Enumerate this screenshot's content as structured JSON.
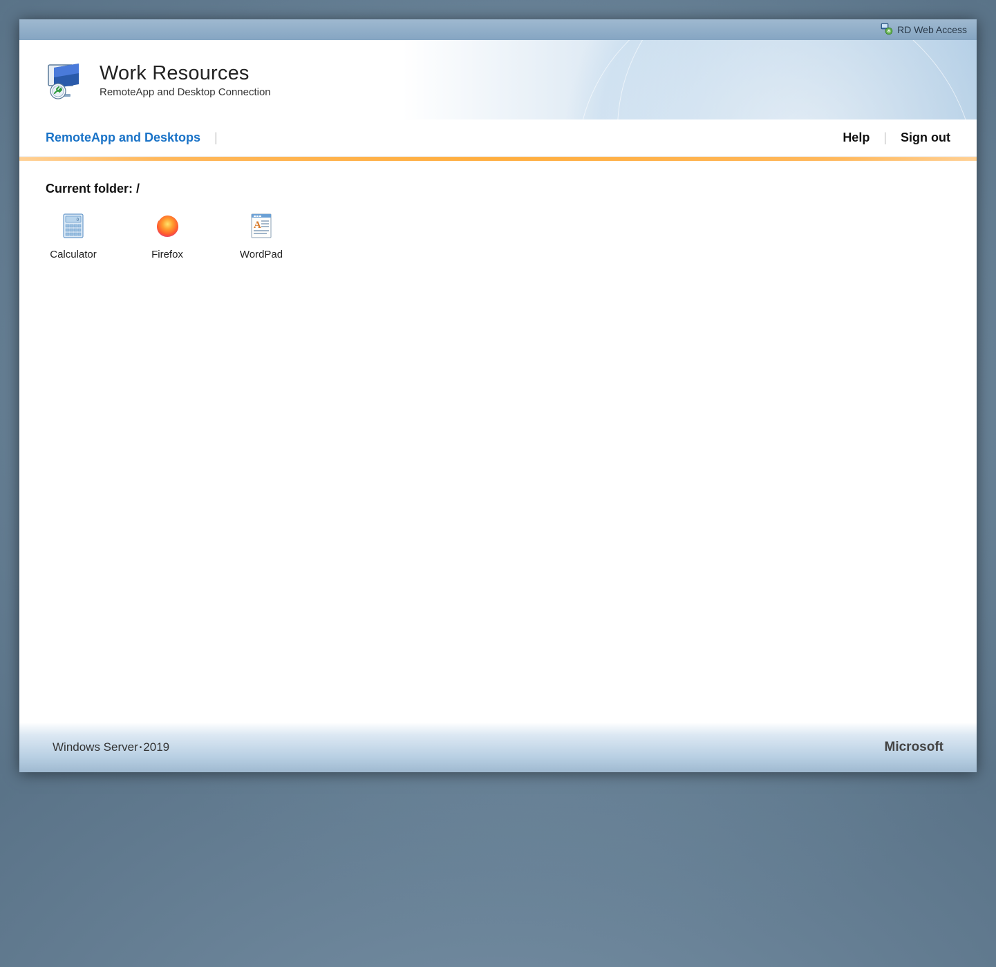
{
  "topbar": {
    "title": "RD Web Access"
  },
  "header": {
    "title": "Work Resources",
    "subtitle": "RemoteApp and Desktop Connection"
  },
  "nav": {
    "active_tab": "RemoteApp and Desktops",
    "help": "Help",
    "signout": "Sign out"
  },
  "content": {
    "folder_label": "Current folder: /",
    "apps": [
      {
        "name": "Calculator",
        "icon": "calculator"
      },
      {
        "name": "Firefox",
        "icon": "firefox"
      },
      {
        "name": "WordPad",
        "icon": "wordpad"
      }
    ]
  },
  "footer": {
    "product": "Windows Server",
    "year": "2019",
    "vendor": "Microsoft"
  }
}
